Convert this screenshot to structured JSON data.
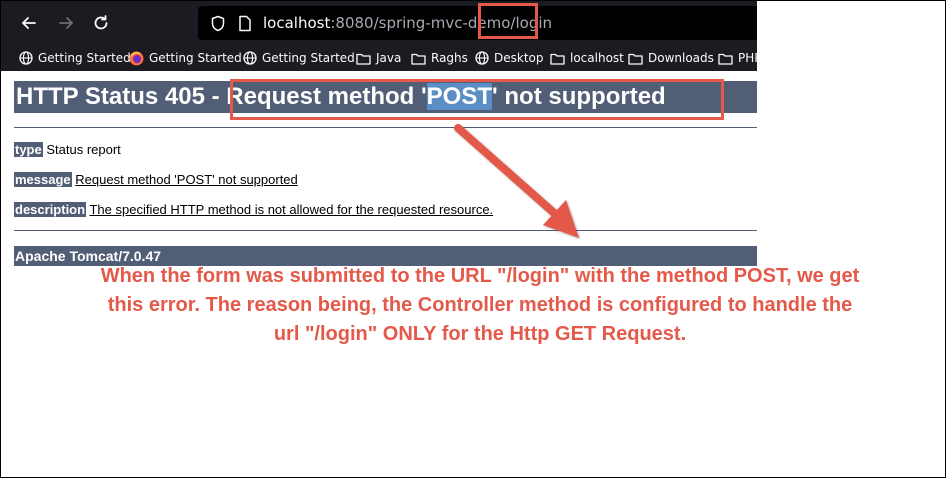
{
  "browser": {
    "url_host": "localhost",
    "url_path": ":8080/spring-mvc-demo/login",
    "bookmarks": [
      {
        "label": "Getting Started",
        "icon": "globe-icon"
      },
      {
        "label": "Getting Started",
        "icon": "firefox-icon"
      },
      {
        "label": "Getting Started",
        "icon": "globe-icon"
      },
      {
        "label": "Java",
        "icon": "folder-icon"
      },
      {
        "label": "Raghs",
        "icon": "folder-icon"
      },
      {
        "label": "Desktop",
        "icon": "globe-icon"
      },
      {
        "label": "localhost",
        "icon": "folder-icon"
      },
      {
        "label": "Downloads",
        "icon": "folder-icon"
      },
      {
        "label": "PHP",
        "icon": "folder-icon"
      }
    ]
  },
  "page": {
    "title_prefix": "HTTP Status 405 - ",
    "title_main_a": "Request method '",
    "title_selected": "POST",
    "title_main_b": "' not supported",
    "rows": {
      "type_label": "type",
      "type_value": "Status report",
      "message_label": "message",
      "message_value": "Request method 'POST' not supported",
      "description_label": "description",
      "description_value": "The specified HTTP method is not allowed for the requested resource."
    },
    "footer": "Apache Tomcat/7.0.47"
  },
  "annotation": {
    "text": "When the form was submitted to the URL \"/login\" with the method POST, we get this error. The reason being, the Controller method is configured to handle the url \"/login\" ONLY for the Http GET Request.",
    "color": "#e4594a"
  }
}
